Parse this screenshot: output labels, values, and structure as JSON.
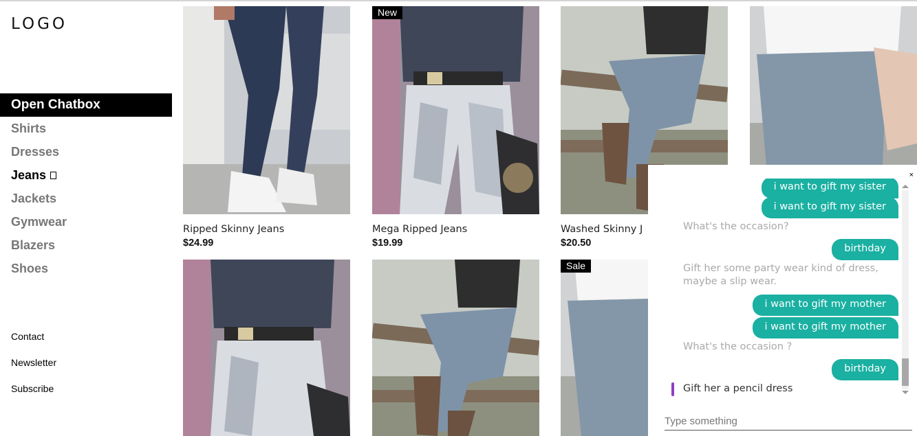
{
  "logo": "LOGO",
  "nav": {
    "chatbox": "Open Chatbox",
    "items": [
      "Shirts",
      "Dresses",
      "Jeans",
      "Jackets",
      "Gymwear",
      "Blazers",
      "Shoes"
    ]
  },
  "footer": [
    "Contact",
    "Newsletter",
    "Subscribe"
  ],
  "products": [
    {
      "name": "Ripped Skinny Jeans",
      "price": "$24.99",
      "badge": ""
    },
    {
      "name": "Mega Ripped Jeans",
      "price": "$19.99",
      "badge": "New"
    },
    {
      "name": "Washed Skinny J",
      "price": "$20.50",
      "badge": ""
    },
    {
      "name": "",
      "price": "",
      "badge": ""
    },
    {
      "name": "",
      "price": "",
      "badge": ""
    },
    {
      "name": "",
      "price": "",
      "badge": ""
    },
    {
      "name": "",
      "price": "",
      "badge": "Sale"
    }
  ],
  "chat": {
    "close": "×",
    "messages": [
      {
        "from": "user",
        "text": "i want to gift my sister"
      },
      {
        "from": "user",
        "text": "i want to gift my sister"
      },
      {
        "from": "bot",
        "text": "What's the occasion?"
      },
      {
        "from": "user",
        "text": "birthday"
      },
      {
        "from": "bot",
        "text": "Gift her some party wear kind of dress, maybe a slip wear."
      },
      {
        "from": "user",
        "text": "i want to gift my mother"
      },
      {
        "from": "user",
        "text": "i want to gift my mother"
      },
      {
        "from": "bot",
        "text": "What's the occasion ?"
      },
      {
        "from": "user",
        "text": "birthday"
      },
      {
        "from": "bot",
        "text": "Gift her a pencil dress"
      }
    ],
    "placeholder": "Type something"
  },
  "colors": {
    "chat_bubble": "#1ab0a2",
    "typing_indicator": "#8b3fc2",
    "nav_active_bg": "#000000"
  }
}
